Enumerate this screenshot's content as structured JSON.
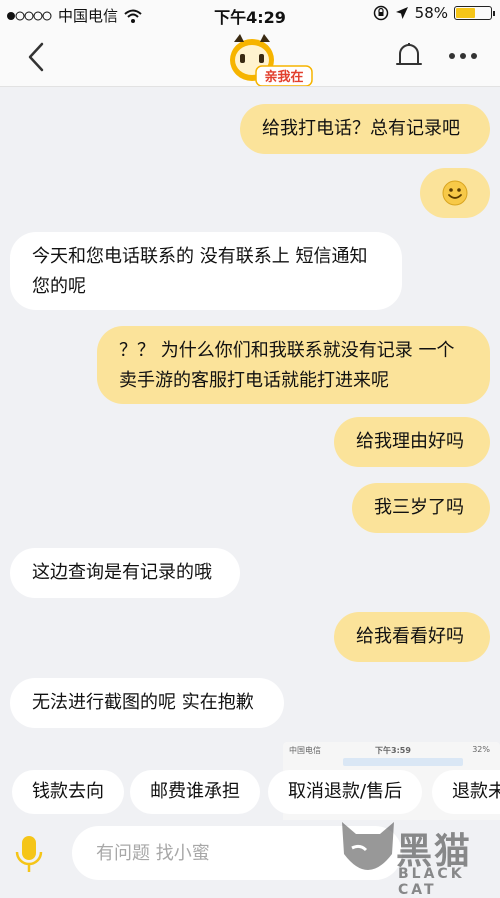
{
  "status_bar": {
    "carrier": "中国电信",
    "time": "下午4:29",
    "battery": "58%",
    "battery_level": 0.58
  },
  "nav": {
    "logo_text": "亲我在"
  },
  "messages": [
    {
      "side": "me",
      "text": "给我打电话？总有记录吧"
    },
    {
      "side": "me",
      "text": "🙂"
    },
    {
      "side": "them",
      "text": "今天和您电话联系的 没有联系上 短信通知您的呢"
    },
    {
      "side": "me",
      "text": "？？ 为什么你们和我联系就没有记录 一个卖手游的客服打电话就能打进来呢"
    },
    {
      "side": "me",
      "text": "给我理由好吗"
    },
    {
      "side": "me",
      "text": "我三岁了吗"
    },
    {
      "side": "them",
      "text": "这边查询是有记录的哦"
    },
    {
      "side": "me",
      "text": "给我看看好吗"
    },
    {
      "side": "them",
      "text": "无法进行截图的呢 实在抱歉"
    }
  ],
  "quick_replies": [
    "钱款去向",
    "邮费谁承担",
    "取消退款/售后",
    "退款未"
  ],
  "input": {
    "placeholder": "有问题 找小蜜"
  },
  "thumbnail": {
    "carrier": "中国电信",
    "time": "下午3:59",
    "battery": "32%"
  },
  "watermark": {
    "main": "黑猫",
    "sub": "BLACK CAT"
  },
  "colors": {
    "my_bubble": "#fbe39a",
    "their_bubble": "#ffffff",
    "background": "#f0f1f4",
    "accent": "#f5c518"
  }
}
